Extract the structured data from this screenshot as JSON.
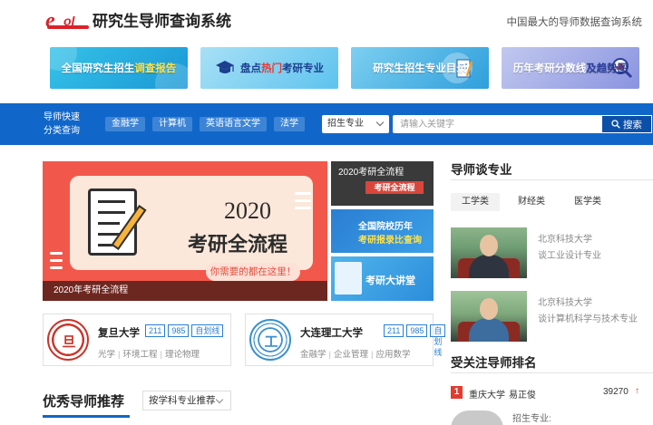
{
  "header": {
    "logo_text": "eol",
    "site_title": "研究生导师查询系统",
    "slogan": "中国最大的导师数据查询系统"
  },
  "banners": [
    {
      "prefix": "全国研究生招生",
      "highlight": "调查报告"
    },
    {
      "prefix": "盘点",
      "highlight": "热门",
      "suffix": "考研专业"
    },
    {
      "prefix": "研究生招生专业目录"
    },
    {
      "prefix": "历年考研分数线",
      "highlight": "及趋势图"
    }
  ],
  "nav": {
    "label_line1": "导师快速",
    "label_line2": "分类查询",
    "tags": [
      "金融学",
      "计算机",
      "英语语言文学",
      "法学"
    ],
    "search_type": "招生专业",
    "search_placeholder": "请输入关键字",
    "search_button": "搜索"
  },
  "hero": {
    "year": "2020",
    "title": "考研全流程",
    "subtitle": "你需要的都在这里！",
    "caption": "2020年考研全流程"
  },
  "thumbs": [
    {
      "line1": "2020考研全流程",
      "line2": "考研全流程"
    },
    {
      "line1": "全国院校历年",
      "line2": "考研报录比查询"
    },
    {
      "line1": "考研大讲堂"
    }
  ],
  "universities": [
    {
      "name": "复旦大学",
      "seal_char": "旦",
      "badges": [
        "211",
        "985",
        "自划线"
      ],
      "majors": [
        "光学",
        "环境工程",
        "理论物理"
      ]
    },
    {
      "name": "大连理工大学",
      "seal_char": "工",
      "badges": [
        "211",
        "985",
        "自划线"
      ],
      "majors": [
        "金融学",
        "企业管理",
        "应用数学"
      ]
    }
  ],
  "recommend": {
    "title": "优秀导师推荐",
    "filter": "按学科专业推荐"
  },
  "sidebar": {
    "talk_title": "导师谈专业",
    "tabs": [
      "工学类",
      "财经类",
      "医学类"
    ],
    "mentors": [
      {
        "university": "北京科技大学",
        "topic": "谈工业设计专业"
      },
      {
        "university": "北京科技大学",
        "topic": "谈计算机科学与技术专业"
      }
    ],
    "rank_title": "受关注导师排名",
    "rank": {
      "num": "1",
      "university": "重庆大学",
      "name": "易正俊",
      "value": "39270",
      "arrow": "↑"
    },
    "rank_detail_label": "招生专业:"
  },
  "colors": {
    "nav_blue": "#1167c9",
    "accent_red": "#e43b2f",
    "badge_blue": "#2a7fd4"
  }
}
